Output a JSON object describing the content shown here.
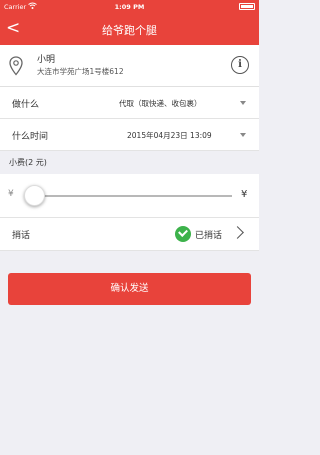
{
  "status_bar": {
    "carrier": "Carrier",
    "wifi_icon": "wifi-icon",
    "time": "1:09 PM",
    "battery_icon": "battery-icon"
  },
  "nav": {
    "back_icon": "chevron-left-icon",
    "back_glyph": "<",
    "title": "给爷跑个腿"
  },
  "address": {
    "name": "小明",
    "line": "大连市学苑广场1号楼612",
    "info_glyph": "i"
  },
  "form": {
    "what_label": "做什么",
    "what_value": "代取（取快递、收包裹）",
    "when_label": "什么时间",
    "when_value": "2015年04月23日 13:09",
    "fee_label": "小费(2 元)",
    "fee_min_symbol": "¥",
    "fee_max_symbol": "¥",
    "fee_slider_value": 0,
    "message_label": "捎话",
    "message_value": "已捎话"
  },
  "confirm_label": "确认发送",
  "colors": {
    "brand_red": "#e8433b",
    "check_green": "#3db24b",
    "background": "#efeff4"
  }
}
